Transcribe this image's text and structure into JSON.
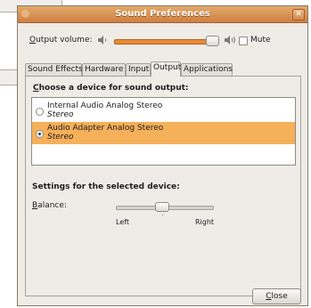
{
  "window": {
    "title": "Sound Preferences",
    "close_glyph": "✕"
  },
  "output_volume": {
    "label_prefix": "O",
    "label_rest": "utput volume:",
    "mute_label": "Mute",
    "level_percent": 90,
    "muted": false
  },
  "tabs": [
    {
      "label": "Sound Effects",
      "active": false
    },
    {
      "label": "Hardware",
      "active": false
    },
    {
      "label": "Input",
      "active": false
    },
    {
      "label": "Output",
      "active": true
    },
    {
      "label": "Applications",
      "active": false
    }
  ],
  "output": {
    "choose_prefix": "C",
    "choose_rest": "hoose a device for sound output:",
    "devices": [
      {
        "name": "Internal Audio Analog Stereo",
        "desc": "Stereo",
        "selected": false
      },
      {
        "name": "Audio Adapter Analog Stereo",
        "desc": "Stereo",
        "selected": true
      }
    ],
    "settings_title": "Settings for the selected device:",
    "balance_prefix": "B",
    "balance_rest": "alance:",
    "balance_left": "Left",
    "balance_right": "Right",
    "balance_value": 0.48
  },
  "buttons": {
    "close_prefix": "C",
    "close_rest": "lose"
  },
  "colors": {
    "accent": "#e88b35",
    "titlebar": "#cf7f42",
    "selection": "#f5b05a"
  },
  "icons": {
    "volume_min": "speaker-low-icon",
    "volume_max": "speaker-high-icon"
  }
}
